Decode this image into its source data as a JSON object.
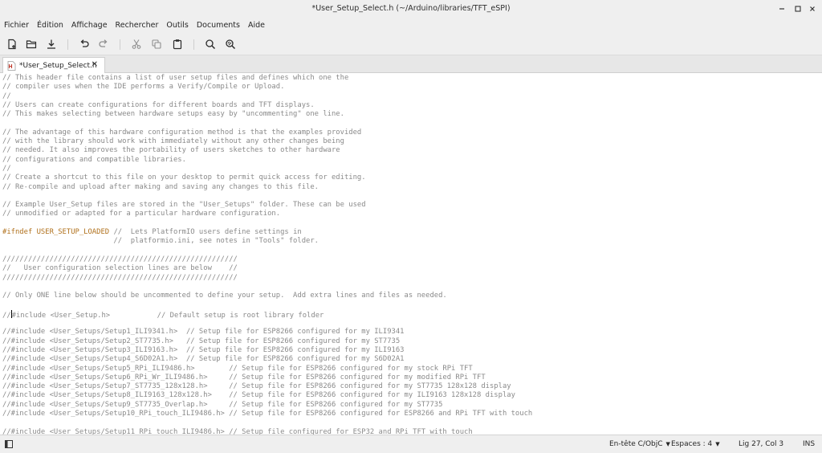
{
  "window": {
    "title": "*User_Setup_Select.h (~/Arduino/libraries/TFT_eSPI)"
  },
  "menubar": {
    "items": [
      "Fichier",
      "Édition",
      "Affichage",
      "Rechercher",
      "Outils",
      "Documents",
      "Aide"
    ]
  },
  "toolbar": {
    "buttons": [
      "new-document-icon",
      "open-folder-icon",
      "save-download-icon",
      "undo-icon",
      "redo-icon",
      "cut-scissors-icon",
      "copy-icon",
      "paste-clipboard-icon",
      "search-icon",
      "search-replace-icon"
    ]
  },
  "tabs": [
    {
      "label": "*User_Setup_Select.h",
      "close": "✕"
    }
  ],
  "editor": {
    "lines": [
      "// This header file contains a list of user setup files and defines which one the",
      "// compiler uses when the IDE performs a Verify/Compile or Upload.",
      "//",
      "// Users can create configurations for different boards and TFT displays.",
      "// This makes selecting between hardware setups easy by \"uncommenting\" one line.",
      "",
      "// The advantage of this hardware configuration method is that the examples provided",
      "// with the library should work with immediately without any other changes being",
      "// needed. It also improves the portability of users sketches to other hardware",
      "// configurations and compatible libraries.",
      "//",
      "// Create a shortcut to this file on your desktop to permit quick access for editing.",
      "// Re-compile and upload after making and saving any changes to this file.",
      "",
      "// Example User_Setup files are stored in the \"User_Setups\" folder. These can be used",
      "// unmodified or adapted for a particular hardware configuration.",
      "",
      "#ifndef USER_SETUP_LOADED //  Lets PlatformIO users define settings in",
      "                          //  platformio.ini, see notes in \"Tools\" folder.",
      "",
      "///////////////////////////////////////////////////////",
      "//   User configuration selection lines are below    //",
      "///////////////////////////////////////////////////////",
      "",
      "// Only ONE line below should be uncommented to define your setup.  Add extra lines and files as needed.",
      "",
      "//#include <User_Setup.h>           // Default setup is root library folder",
      "",
      "//#include <User_Setups/Setup1_ILI9341.h>  // Setup file for ESP8266 configured for my ILI9341",
      "//#include <User_Setups/Setup2_ST7735.h>   // Setup file for ESP8266 configured for my ST7735",
      "//#include <User_Setups/Setup3_ILI9163.h>  // Setup file for ESP8266 configured for my ILI9163",
      "//#include <User_Setups/Setup4_S6D02A1.h>  // Setup file for ESP8266 configured for my S6D02A1",
      "//#include <User_Setups/Setup5_RPi_ILI9486.h>        // Setup file for ESP8266 configured for my stock RPi TFT",
      "//#include <User_Setups/Setup6_RPi_Wr_ILI9486.h>     // Setup file for ESP8266 configured for my modified RPi TFT",
      "//#include <User_Setups/Setup7_ST7735_128x128.h>     // Setup file for ESP8266 configured for my ST7735 128x128 display",
      "//#include <User_Setups/Setup8_ILI9163_128x128.h>    // Setup file for ESP8266 configured for my ILI9163 128x128 display",
      "//#include <User_Setups/Setup9_ST7735_Overlap.h>     // Setup file for ESP8266 configured for my ST7735",
      "//#include <User_Setups/Setup10_RPi_touch_ILI9486.h> // Setup file for ESP8266 configured for ESP8266 and RPi TFT with touch",
      "",
      "//#include <User_Setups/Setup11_RPi_touch_ILI9486.h> // Setup file configured for ESP32 and RPi TFT with touch"
    ],
    "keyword_color": "#b0701b",
    "comment_color": "#8a8a8a"
  },
  "statusbar": {
    "language": "En-tête C/ObjC",
    "indent": "Espaces : 4",
    "position": "Lig 27, Col 3",
    "mode": "INS"
  }
}
